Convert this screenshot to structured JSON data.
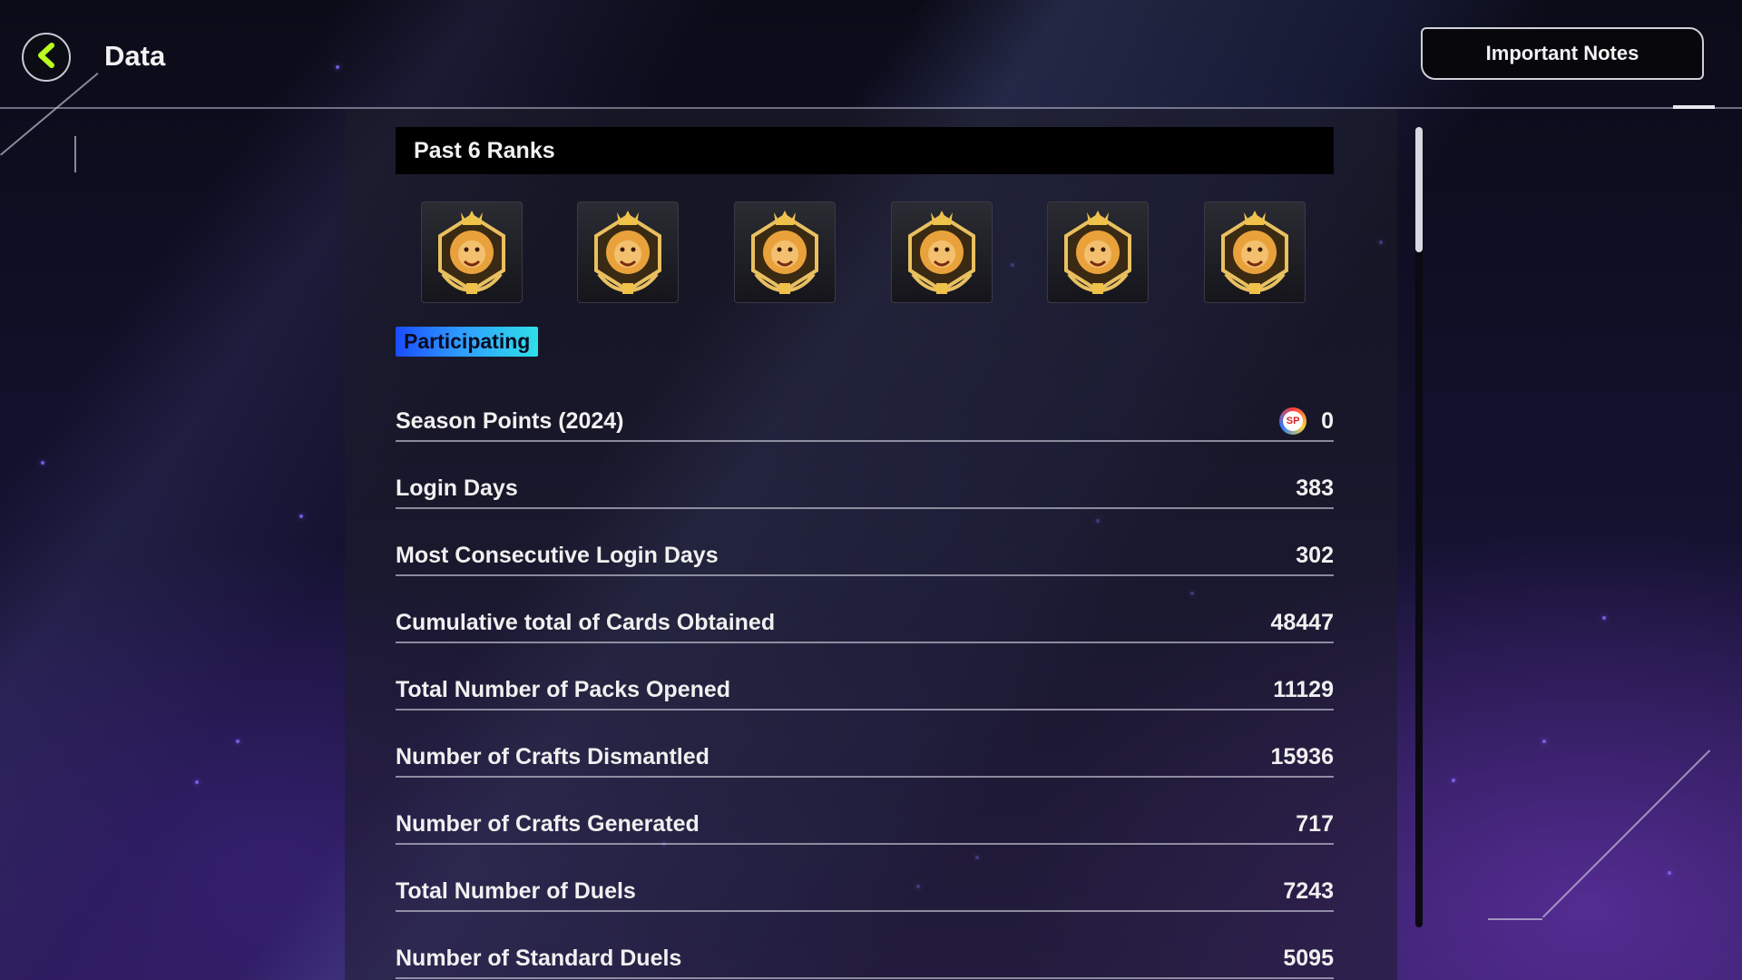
{
  "header": {
    "title": "Data",
    "notes_label": "Important Notes"
  },
  "ranks": {
    "title": "Past 6 Ranks",
    "badges": [
      "lion-rank-badge",
      "lion-rank-badge",
      "lion-rank-badge",
      "lion-rank-badge",
      "lion-rank-badge",
      "lion-rank-badge"
    ],
    "status": "Participating"
  },
  "stats": [
    {
      "label": "Season Points (2024)",
      "value": "0",
      "icon": "season-points-icon",
      "icon_text": "SP"
    },
    {
      "label": "Login Days",
      "value": "383"
    },
    {
      "label": "Most Consecutive Login Days",
      "value": "302"
    },
    {
      "label": "Cumulative total of Cards Obtained",
      "value": "48447"
    },
    {
      "label": "Total Number of Packs Opened",
      "value": "11129"
    },
    {
      "label": "Number of Crafts Dismantled",
      "value": "15936"
    },
    {
      "label": "Number of Crafts Generated",
      "value": "717"
    },
    {
      "label": "Total Number of Duels",
      "value": "7243"
    },
    {
      "label": "Number of Standard Duels",
      "value": "5095"
    }
  ],
  "colors": {
    "accent_back": "#b8ff1e",
    "status_gradient_start": "#1a4dff",
    "status_gradient_end": "#2ee0e8",
    "badge_gold": "#e9a23b"
  }
}
